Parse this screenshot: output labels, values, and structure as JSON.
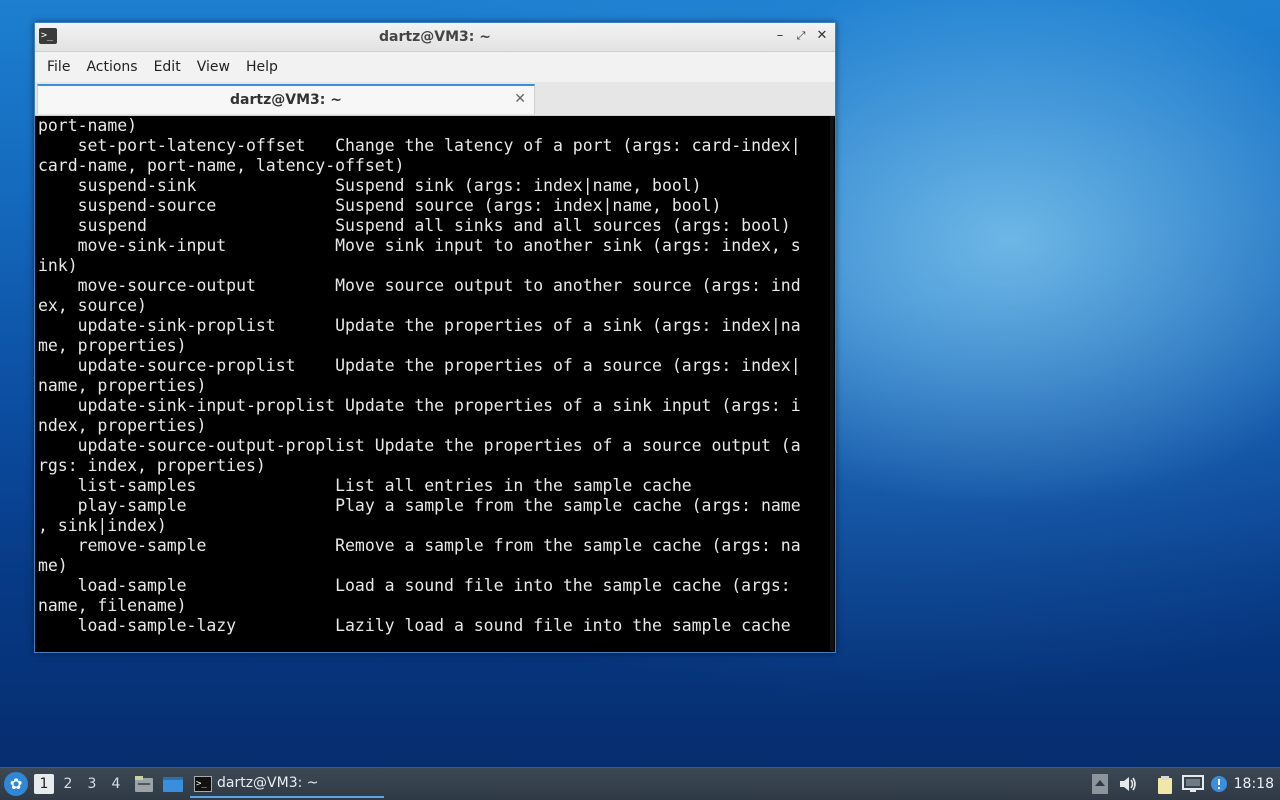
{
  "window": {
    "title": "dartz@VM3: ~",
    "menu": [
      "File",
      "Actions",
      "Edit",
      "View",
      "Help"
    ],
    "tab_label": "dartz@VM3: ~"
  },
  "terminal": {
    "lines": [
      "port-name)",
      "    set-port-latency-offset   Change the latency of a port (args: card-index|",
      "card-name, port-name, latency-offset)",
      "    suspend-sink              Suspend sink (args: index|name, bool)",
      "    suspend-source            Suspend source (args: index|name, bool)",
      "    suspend                   Suspend all sinks and all sources (args: bool)",
      "    move-sink-input           Move sink input to another sink (args: index, s",
      "ink)",
      "    move-source-output        Move source output to another source (args: ind",
      "ex, source)",
      "    update-sink-proplist      Update the properties of a sink (args: index|na",
      "me, properties)",
      "    update-source-proplist    Update the properties of a source (args: index|",
      "name, properties)",
      "    update-sink-input-proplist Update the properties of a sink input (args: i",
      "ndex, properties)",
      "    update-source-output-proplist Update the properties of a source output (a",
      "rgs: index, properties)",
      "    list-samples              List all entries in the sample cache",
      "    play-sample               Play a sample from the sample cache (args: name",
      ", sink|index)",
      "    remove-sample             Remove a sample from the sample cache (args: na",
      "me)",
      "    load-sample               Load a sound file into the sample cache (args:",
      "name, filename)",
      "    load-sample-lazy          Lazily load a sound file into the sample cache"
    ]
  },
  "taskbar": {
    "workspaces": [
      "1",
      "2",
      "3",
      "4"
    ],
    "active_workspace": "1",
    "task_label": "dartz@VM3: ~",
    "clock": "18:18"
  },
  "colors": {
    "accent": "#3b8ede",
    "terminal_bg": "#000000",
    "terminal_fg": "#e8e8e8"
  }
}
